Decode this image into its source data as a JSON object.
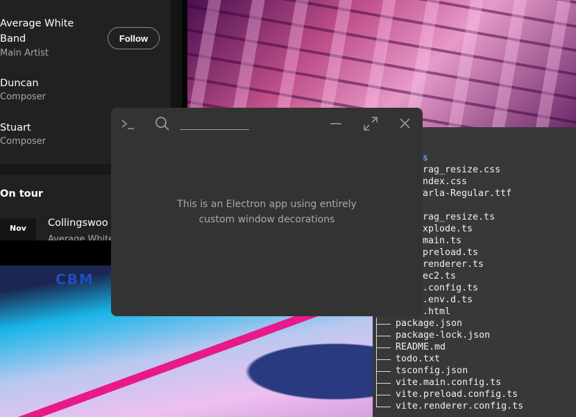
{
  "artist_panel": {
    "credits": [
      {
        "name": "Average White Band",
        "role": "Main Artist"
      },
      {
        "name": "Duncan",
        "role": "Composer"
      },
      {
        "name": "Stuart",
        "role": "Composer"
      }
    ],
    "follow_label": "Follow",
    "on_tour_title": "On tour",
    "tour": {
      "month": "Nov",
      "venue": "Collingswoo",
      "artist": "Average White"
    }
  },
  "photo_text": "CBM",
  "terminal": {
    "lines": [
      {
        "text": "s",
        "dir": true
      },
      {
        "text": "rag_resize.css"
      },
      {
        "text": "ndex.css"
      },
      {
        "text": "arla-Regular.ttf"
      },
      {
        "text": ""
      },
      {
        "text": "rag_resize.ts"
      },
      {
        "text": "xplode.ts"
      },
      {
        "text": "main.ts"
      },
      {
        "text": "preload.ts"
      },
      {
        "text": "renderer.ts"
      },
      {
        "text": "ec2.ts"
      },
      {
        "text": ".config.ts"
      },
      {
        "text": ".env.d.ts"
      },
      {
        "text": ".html"
      }
    ],
    "root_files": [
      "package.json",
      "package-lock.json",
      "README.md",
      "todo.txt",
      "tsconfig.json",
      "vite.main.config.ts",
      "vite.preload.config.ts",
      "vite.renderer.config.ts"
    ]
  },
  "dialog": {
    "message_line1": "This is an Electron app using entirely",
    "message_line2": "custom window decorations",
    "search_value": ""
  },
  "colors": {
    "dialog_bg": "#333333",
    "terminal_bg": "#383838",
    "dir_blue": "#6a9fd8"
  }
}
